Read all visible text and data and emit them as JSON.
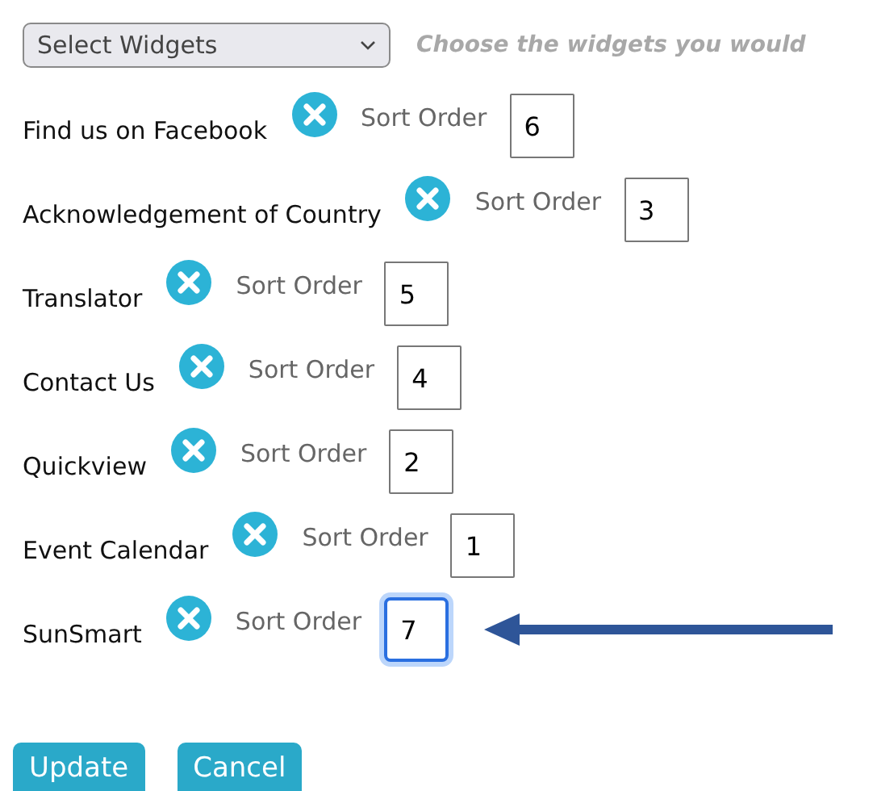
{
  "select": {
    "value": "Select Widgets",
    "hint": "Choose the widgets you would"
  },
  "widgets": [
    {
      "name": "Find us on Facebook",
      "sort_label": "Sort Order",
      "order": "6",
      "focused": false
    },
    {
      "name": "Acknowledgement of Country",
      "sort_label": "Sort Order",
      "order": "3",
      "focused": false
    },
    {
      "name": "Translator",
      "sort_label": "Sort Order",
      "order": "5",
      "focused": false
    },
    {
      "name": "Contact Us",
      "sort_label": "Sort Order",
      "order": "4",
      "focused": false
    },
    {
      "name": "Quickview",
      "sort_label": "Sort Order",
      "order": "2",
      "focused": false
    },
    {
      "name": "Event Calendar",
      "sort_label": "Sort Order",
      "order": "1",
      "focused": false
    },
    {
      "name": "SunSmart",
      "sort_label": "Sort Order",
      "order": "7",
      "focused": true
    }
  ],
  "buttons": [
    "Update",
    "Cancel"
  ]
}
